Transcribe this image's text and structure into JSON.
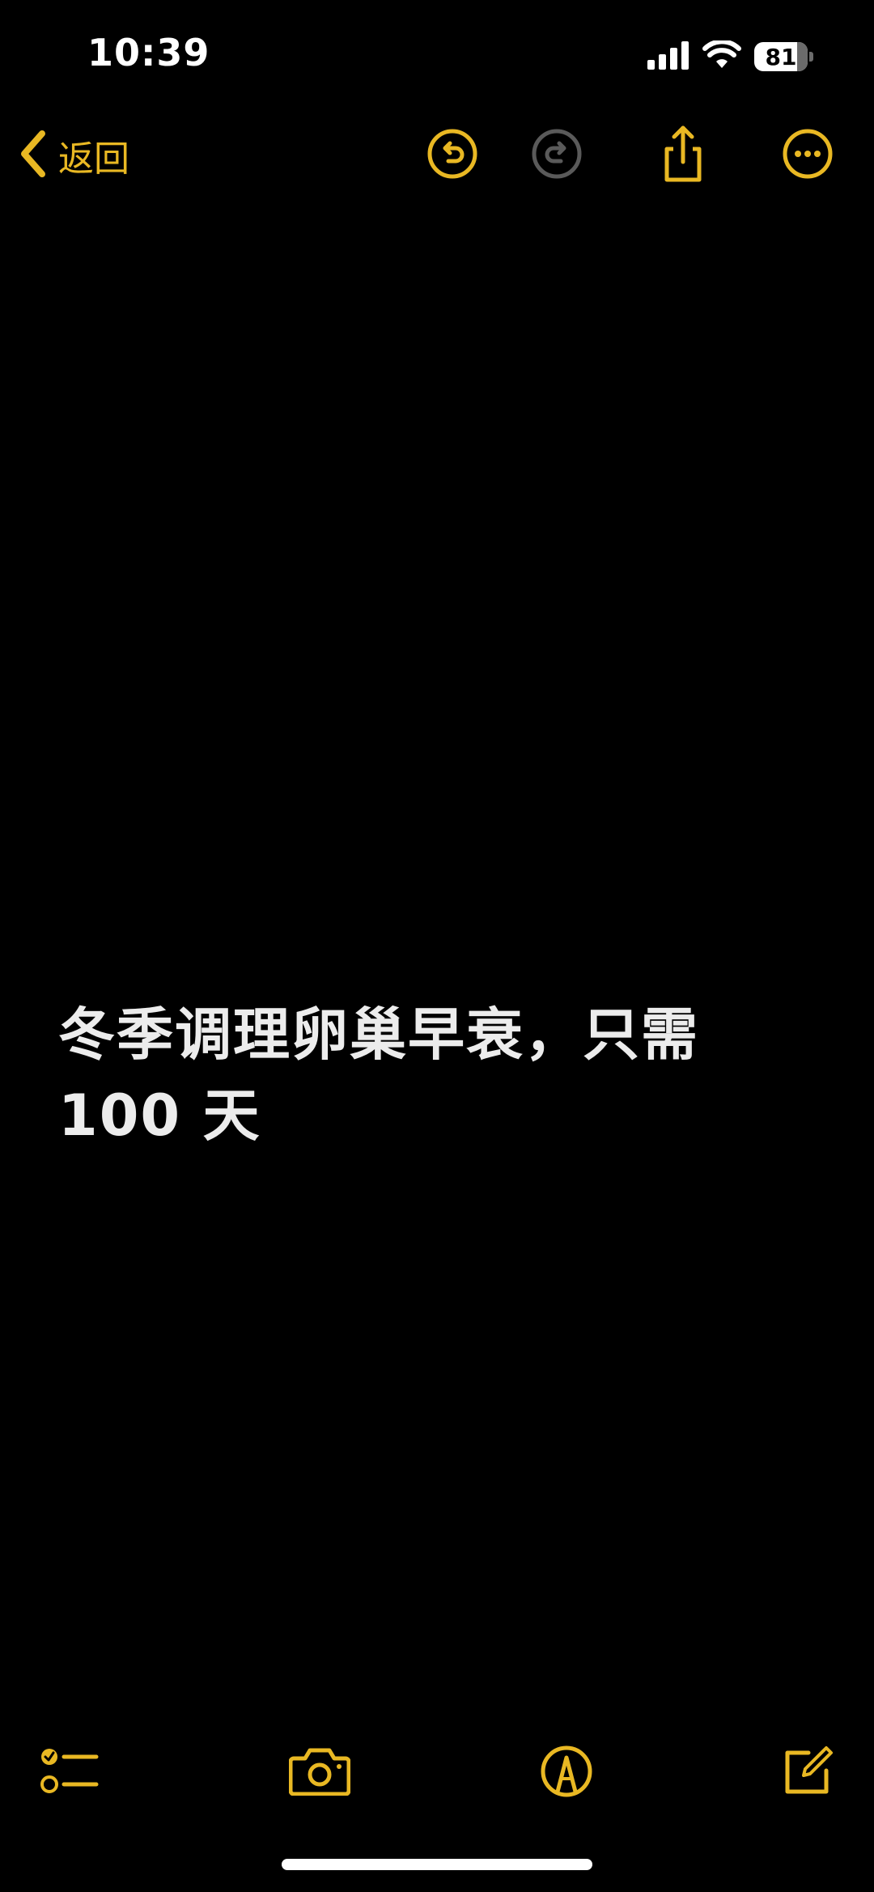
{
  "status_bar": {
    "time": "10:39",
    "battery_percent": "81",
    "battery_level": 0.81,
    "icons": [
      "cellular-signal-icon",
      "wifi-icon",
      "battery-icon"
    ]
  },
  "nav": {
    "back_label": "返回",
    "icons": [
      "chevron-left-icon",
      "undo-icon",
      "redo-icon",
      "share-icon",
      "more-icon"
    ],
    "redo_enabled": false
  },
  "note": {
    "title_line1": "冬季调理卵巢早衰，只需",
    "title_line2": "100 天"
  },
  "toolbar": {
    "icons": [
      "checklist-icon",
      "camera-icon",
      "markup-icon",
      "compose-icon"
    ]
  },
  "colors": {
    "accent": "#E9B823",
    "background": "#000000",
    "text": "#ECECEC",
    "disabled": "#5A5A5A"
  }
}
